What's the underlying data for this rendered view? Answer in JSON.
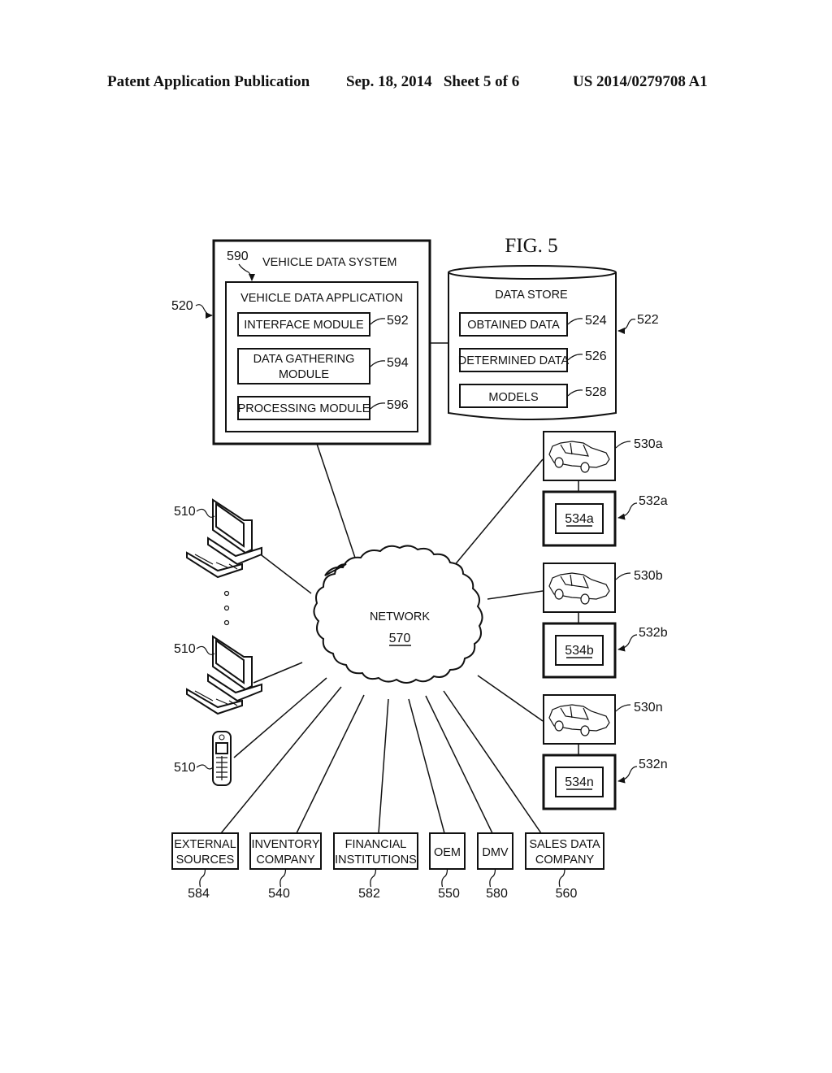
{
  "header": {
    "publication": "Patent Application Publication",
    "date_sheet": "Sep. 18, 2014   Sheet 5 of 6",
    "number": "US 2014/0279708 A1"
  },
  "figure_title": "FIG. 5",
  "vehicle_data_system": {
    "ref": "520",
    "title": "VEHICLE DATA SYSTEM",
    "application": {
      "ref": "590",
      "title": "VEHICLE DATA APPLICATION",
      "modules": [
        {
          "label": "INTERFACE MODULE",
          "ref": "592"
        },
        {
          "label_line1": "DATA GATHERING",
          "label_line2": "MODULE",
          "ref": "594"
        },
        {
          "label": "PROCESSING MODULE",
          "ref": "596"
        }
      ]
    }
  },
  "data_store": {
    "ref": "522",
    "title": "DATA STORE",
    "items": [
      {
        "label": "OBTAINED DATA",
        "ref": "524"
      },
      {
        "label": "DETERMINED DATA",
        "ref": "526"
      },
      {
        "label": "MODELS",
        "ref": "528"
      }
    ]
  },
  "network": {
    "label": "NETWORK",
    "ref": "570"
  },
  "client_devices": [
    {
      "type": "desktop-computer",
      "ref": "510"
    },
    {
      "type": "desktop-computer",
      "ref": "510"
    },
    {
      "type": "mobile-phone",
      "ref": "510"
    }
  ],
  "vehicles": [
    {
      "vehicle_ref": "530a",
      "device_ref": "532a",
      "inner_ref": "534a"
    },
    {
      "vehicle_ref": "530b",
      "device_ref": "532b",
      "inner_ref": "534b"
    },
    {
      "vehicle_ref": "530n",
      "device_ref": "532n",
      "inner_ref": "534n"
    }
  ],
  "entities": [
    {
      "line1": "EXTERNAL",
      "line2": "SOURCES",
      "ref": "584"
    },
    {
      "line1": "INVENTORY",
      "line2": "COMPANY",
      "ref": "540"
    },
    {
      "line1": "FINANCIAL",
      "line2": "INSTITUTIONS",
      "ref": "582"
    },
    {
      "line1": "OEM",
      "line2": "",
      "ref": "550"
    },
    {
      "line1": "DMV",
      "line2": "",
      "ref": "580"
    },
    {
      "line1": "SALES DATA",
      "line2": "COMPANY",
      "ref": "560"
    }
  ]
}
